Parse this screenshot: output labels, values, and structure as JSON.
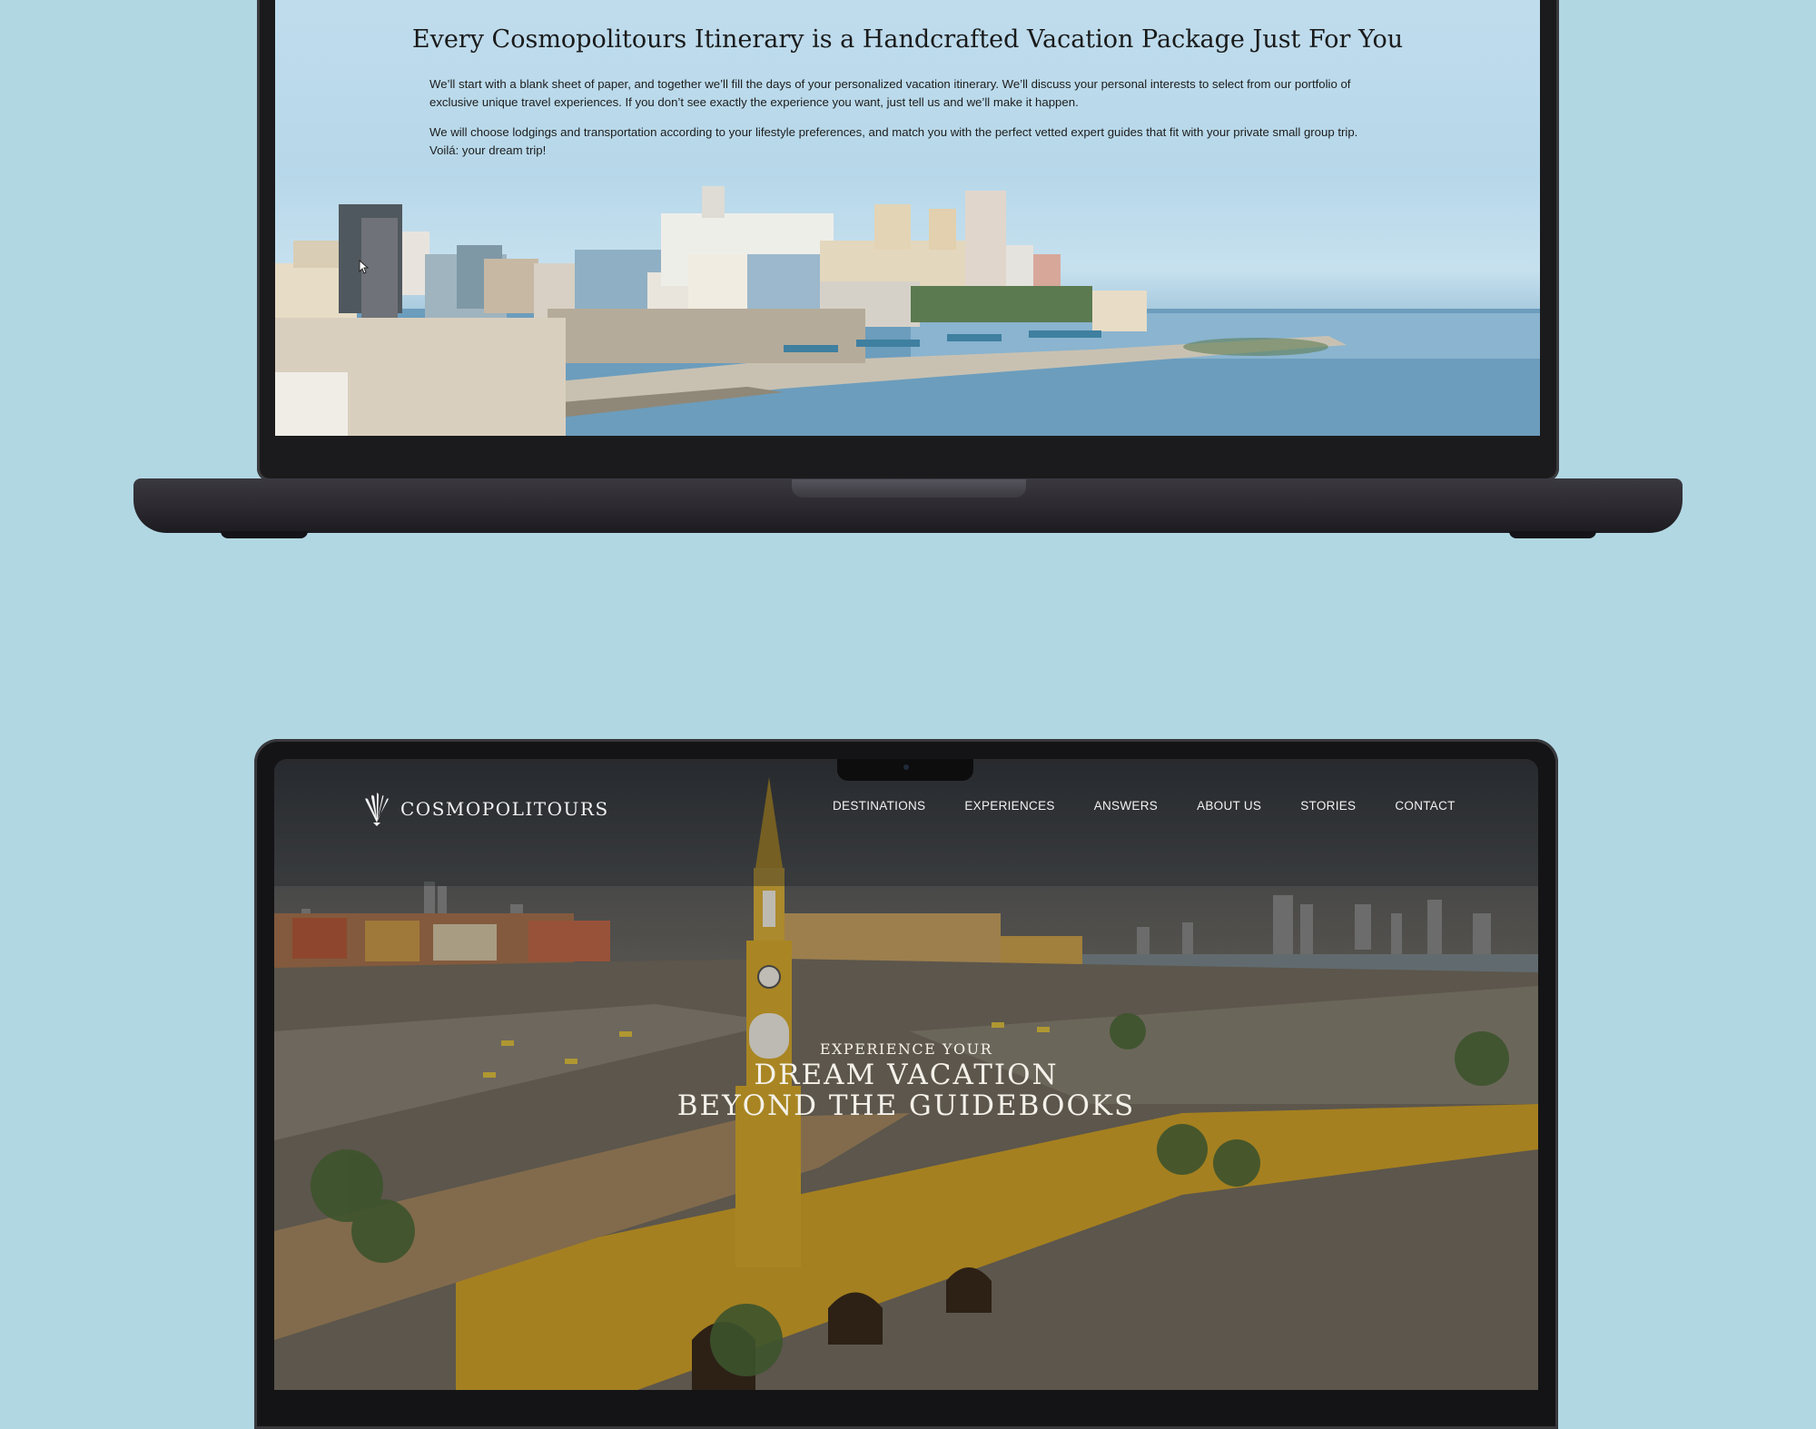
{
  "itinerary_page": {
    "headline": "Every Cosmopolitours Itinerary is a Handcrafted Vacation Package Just For You",
    "paragraph_1": "We’ll start with a blank sheet of paper, and together we’ll fill the days of your personalized vacation itinerary. We’ll discuss your personal interests to select from our portfolio of exclusive unique travel experiences. If you don’t see exactly the experience you want, just tell us and we’ll make it happen.",
    "paragraph_2": "We will choose lodgings and transportation according to your lifestyle preferences, and match you with the perfect vetted expert guides that fit with your private small group trip. Voilá: your dream trip!"
  },
  "home_page": {
    "logo_text": "COSMOPOLITOURS",
    "nav": [
      "DESTINATIONS",
      "EXPERIENCES",
      "ANSWERS",
      "ABOUT US",
      "STORIES",
      "CONTACT"
    ],
    "hero": {
      "kicker": "EXPERIENCE YOUR",
      "line1": "DREAM VACATION",
      "line2": "BEYOND THE GUIDEBOOKS"
    }
  },
  "colors": {
    "background": "#b1d7e3",
    "laptop_body": "#2b292f",
    "clock_tower_yellow": "#d4a52a"
  },
  "icons": [
    "logo-emblem-icon",
    "cursor-icon"
  ]
}
